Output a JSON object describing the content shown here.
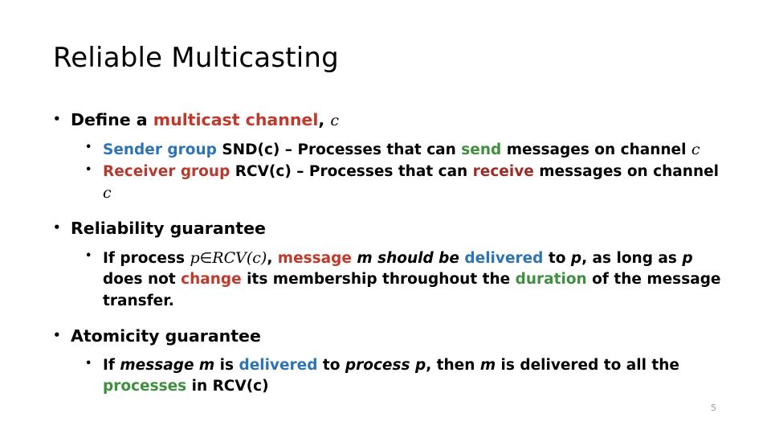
{
  "slide": {
    "title": "Reliable Multicasting",
    "page_number": "5",
    "bullets": {
      "b1": {
        "marker": "•",
        "part1": "Define a ",
        "part2": "multicast channel",
        "part3": ", ",
        "part4": "c"
      },
      "b1s1": {
        "marker": "•",
        "part1": "Sender group",
        "part2": " SND(c) – Processes that can ",
        "part3": "send",
        "part4": " messages on channel ",
        "part5": "c"
      },
      "b1s2": {
        "marker": "•",
        "part1": "Receiver group",
        "part2": " RCV(c) – Processes that can ",
        "part3": "receive",
        "part4": " messages on channel ",
        "part5": "c"
      },
      "b2": {
        "marker": "•",
        "text": "Reliability guarantee"
      },
      "b2s1": {
        "marker": "•",
        "part1": "If process ",
        "math_p": "p",
        "math_in": "∈",
        "math_rcv": "RCV(c)",
        "part2": ", ",
        "part3": "message",
        "part4": " m should be ",
        "part5": "delivered",
        "part6": " to ",
        "part7": "p",
        "part8": ", as long as ",
        "part9": "p",
        "part10": " does not ",
        "part11": "change",
        "part12": " its membership throughout the ",
        "part13": "duration",
        "part14": " of the message transfer."
      },
      "b3": {
        "marker": "•",
        "text": "Atomicity guarantee"
      },
      "b3s1": {
        "marker": "•",
        "part1": "If ",
        "part2": "message m",
        "part3": " is ",
        "part4": "delivered",
        "part5": " to ",
        "part6": "process p",
        "part7": ", then ",
        "part8": "m",
        "part9": " is delivered to all the ",
        "part10": "processes",
        "part11": " in RCV(c)"
      }
    }
  }
}
